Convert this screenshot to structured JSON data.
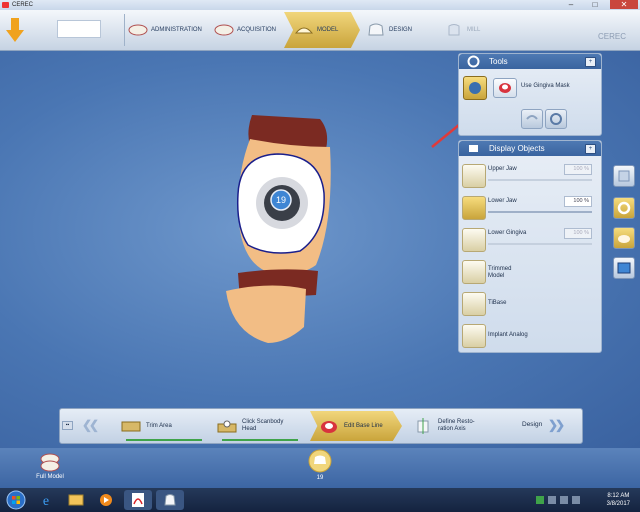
{
  "window": {
    "title": "CEREC",
    "minimize": "–",
    "maximize": "□",
    "close": "✕"
  },
  "phases": [
    {
      "label": "ADMINISTRATION"
    },
    {
      "label": "ACQUISITION"
    },
    {
      "label": "MODEL"
    },
    {
      "label": "DESIGN"
    },
    {
      "label": "MILL"
    }
  ],
  "brand": "CEREC",
  "tools_panel": {
    "title": "Tools",
    "gingiva_mask_label": "Use Gingiva Mask",
    "pin": "+"
  },
  "display_objects": {
    "title": "Display Objects",
    "pin": "+",
    "items": [
      {
        "label": "Upper Jaw",
        "opacity": "100 %",
        "enabled": false
      },
      {
        "label": "Lower Jaw",
        "opacity": "100 %",
        "enabled": true
      },
      {
        "label": "Lower Gingiva",
        "opacity": "100 %",
        "enabled": false
      },
      {
        "label": "Trimmed Model"
      },
      {
        "label": "TiBase"
      },
      {
        "label": "Implant Analog"
      }
    ]
  },
  "tooth_number": "19",
  "steps": [
    {
      "label": "Trim Area",
      "done": true
    },
    {
      "label": "Click Scanbody Head",
      "done": true
    },
    {
      "label": "Edit Base Line",
      "active": true
    },
    {
      "label": "Define Resto-ration Axis",
      "done": false
    }
  ],
  "next_phase_label": "Design",
  "bottom": {
    "full_model_label": "Full Model",
    "restoration_label": "19"
  },
  "taskbar": {
    "time": "8:12 AM",
    "date": "3/8/2017"
  },
  "colors": {
    "accent_gold": "#d9b54a",
    "viewport_blue": "#4a76b3",
    "progress_green": "#3fa34a",
    "margin_line": "#1a1f8c"
  }
}
